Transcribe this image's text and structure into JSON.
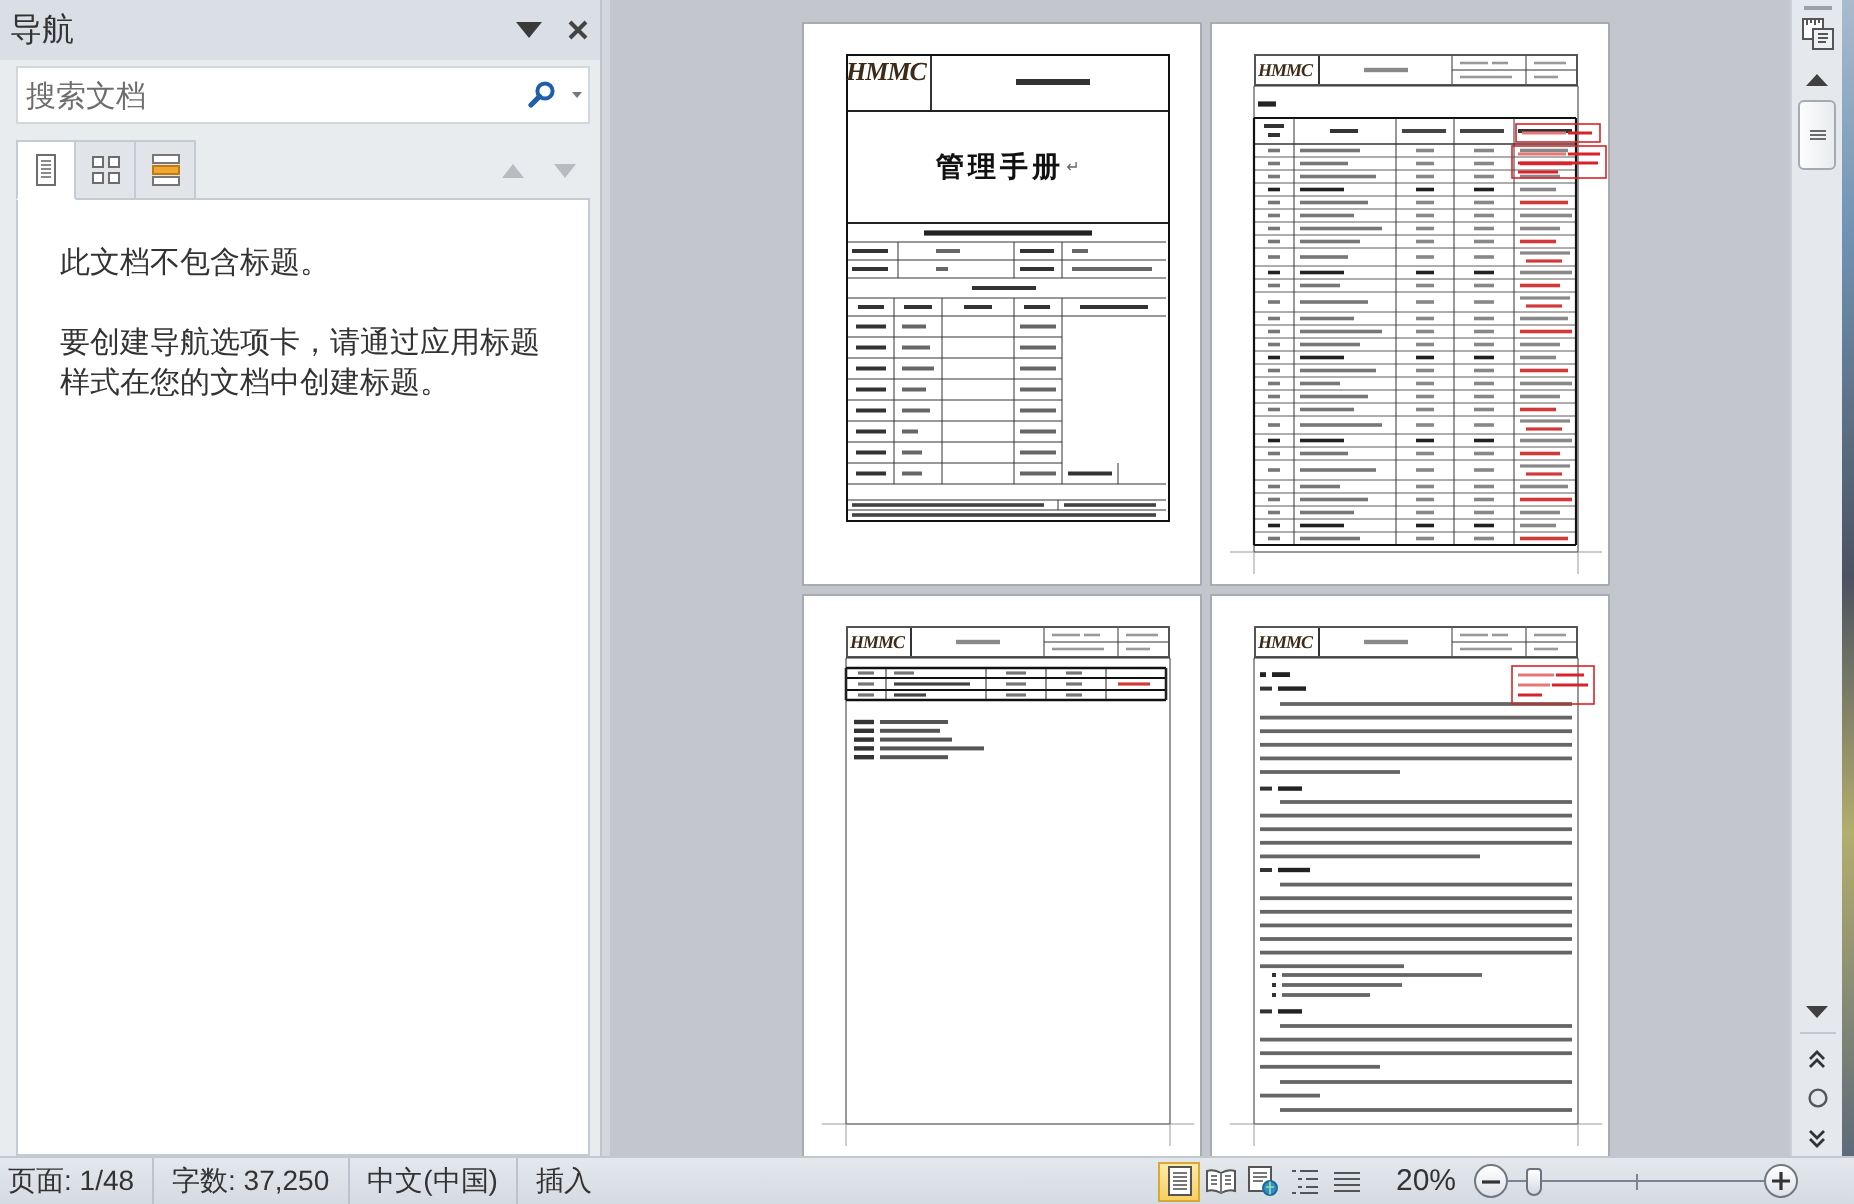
{
  "navigation_pane": {
    "title": "导航",
    "search": {
      "placeholder": "搜索文档"
    },
    "tabs": [
      {
        "selected": true
      },
      {
        "selected": false
      },
      {
        "selected": false
      }
    ],
    "messages": [
      "此文档不包含标题。",
      "要创建导航选项卡，请通过应用标题样式在您的文档中创建标题。"
    ]
  },
  "document": {
    "pages": [
      {
        "kind": "cover",
        "logo": "HMMC",
        "title": "管理手册",
        "paragraph_mark": "↵"
      },
      {
        "kind": "contents",
        "logo": "HMMC"
      },
      {
        "kind": "list",
        "logo": "HMMC"
      },
      {
        "kind": "text",
        "logo": "HMMC"
      }
    ]
  },
  "status_bar": {
    "page": "页面: 1/48",
    "word_count": "字数: 37,250",
    "language": "中文(中国)",
    "mode": "插入",
    "views": [
      {
        "selected": true
      },
      {
        "selected": false
      },
      {
        "selected": false
      },
      {
        "selected": false
      },
      {
        "selected": false
      }
    ],
    "zoom": {
      "reading": "20%",
      "level": 0.1
    }
  }
}
